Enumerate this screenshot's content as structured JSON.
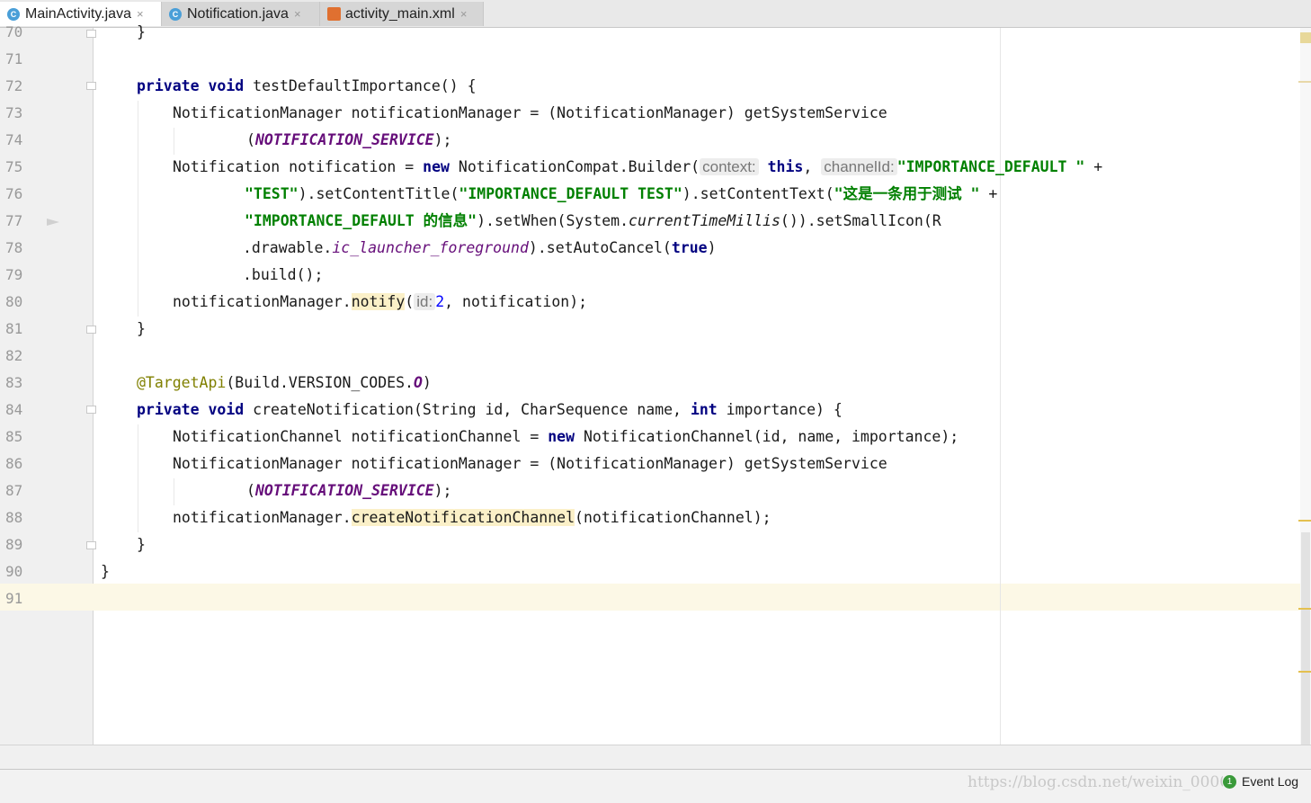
{
  "tabs": [
    {
      "label": "MainActivity.java",
      "icon": "java-class-icon",
      "icon_letter": "C",
      "active": true
    },
    {
      "label": "Notification.java",
      "icon": "java-class-icon",
      "icon_letter": "C",
      "active": false
    },
    {
      "label": "activity_main.xml",
      "icon": "xml-layout-icon",
      "active": false
    }
  ],
  "tab_close": "×",
  "line_numbers": [
    "70",
    "71",
    "72",
    "73",
    "74",
    "75",
    "76",
    "77",
    "78",
    "79",
    "80",
    "81",
    "82",
    "83",
    "84",
    "85",
    "86",
    "87",
    "88",
    "89",
    "90",
    "91"
  ],
  "code": {
    "l70": "}",
    "l72_kw1": "private",
    "l72_kw2": "void",
    "l72_rest": " testDefaultImportance() {",
    "l73": "NotificationManager notificationManager = (NotificationManager) getSystemService",
    "l74_open": "(",
    "l74_const": "NOTIFICATION_SERVICE",
    "l74_close": ");",
    "l75_a": "Notification notification = ",
    "l75_kw": "new",
    "l75_b": " NotificationCompat.Builder(",
    "l75_hint1": "context:",
    "l75_this": "this",
    "l75_comma": ", ",
    "l75_hint2": "channelId:",
    "l75_str": "\"IMPORTANCE_DEFAULT \"",
    "l75_plus": " +",
    "l76_str1": "\"TEST\"",
    "l76_a": ").setContentTitle(",
    "l76_str2": "\"IMPORTANCE_DEFAULT TEST\"",
    "l76_b": ").setContentText(",
    "l76_str3": "\"这是一条用于测试 \"",
    "l76_plus": " +",
    "l77_str": "\"IMPORTANCE_DEFAULT 的信息\"",
    "l77_a": ").setWhen(System.",
    "l77_static": "currentTimeMillis",
    "l77_b": "()).setSmallIcon(R",
    "l78_a": ".drawable.",
    "l78_fld": "ic_launcher_foreground",
    "l78_b": ").setAutoCancel(",
    "l78_kw": "true",
    "l78_c": ")",
    "l79": ".build();",
    "l80_a": "notificationManager.",
    "l80_hl": "notify",
    "l80_open": "(",
    "l80_hint": "id:",
    "l80_num": "2",
    "l80_b": ", notification);",
    "l81": "}",
    "l83_ann": "@TargetApi",
    "l83_a": "(Build.VERSION_CODES.",
    "l83_const": "O",
    "l83_b": ")",
    "l84_kw1": "private",
    "l84_kw2": "void",
    "l84_a": " createNotification(String id, CharSequence name, ",
    "l84_kw3": "int",
    "l84_b": " importance) {",
    "l85_a": "NotificationChannel notificationChannel = ",
    "l85_kw": "new",
    "l85_b": " NotificationChannel(id, name, importance);",
    "l86": "NotificationManager notificationManager = (NotificationManager) getSystemService",
    "l87_open": "(",
    "l87_const": "NOTIFICATION_SERVICE",
    "l87_close": ");",
    "l88_a": "notificationManager.",
    "l88_hl": "createNotificationChannel",
    "l88_b": "(notificationChannel);",
    "l89": "}",
    "l90": "}"
  },
  "status": {
    "event_log_label": "Event Log",
    "event_log_count": "1",
    "watermark": "https://blog.csdn.net/weixin_00000000"
  },
  "colors": {
    "keyword": "#000080",
    "string": "#008000",
    "annotation": "#808000",
    "constant": "#660e7a",
    "number": "#0000ff",
    "current_line": "#fcf8e6"
  }
}
